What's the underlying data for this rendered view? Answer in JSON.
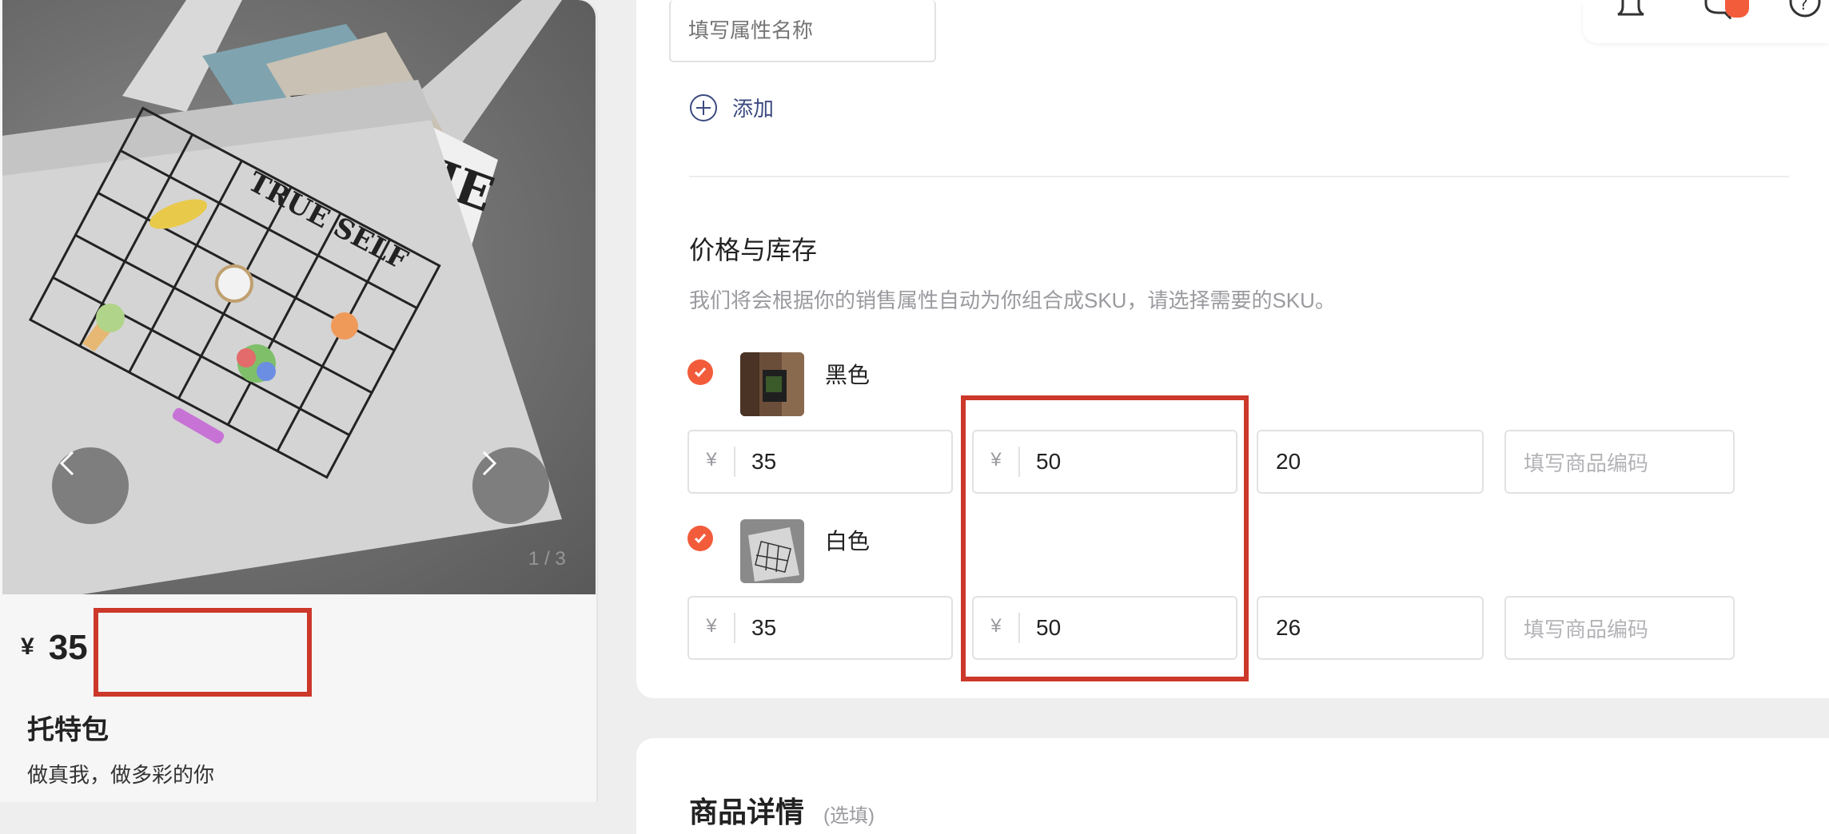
{
  "preview": {
    "page_indicator": "1 / 3",
    "currency": "¥",
    "price": "35",
    "title": "托特包",
    "subtitle": "做真我，做多彩的你",
    "bag_print_text": "TRUE SELF"
  },
  "attributes": {
    "name_placeholder": "填写属性名称",
    "add_label": "添加"
  },
  "pricing": {
    "title": "价格与库存",
    "description": "我们将会根据你的销售属性自动为你组合成SKU，请选择需要的SKU。",
    "currency": "¥",
    "skus": [
      {
        "name": "黑色",
        "checked": true,
        "price": "35",
        "original_price": "50",
        "stock": "20",
        "code_placeholder": "填写商品编码"
      },
      {
        "name": "白色",
        "checked": true,
        "price": "35",
        "original_price": "50",
        "stock": "26",
        "code_placeholder": "填写商品编码"
      }
    ]
  },
  "details": {
    "title": "商品详情",
    "note": "(选填)"
  },
  "colors": {
    "accent": "#f25c3b",
    "highlight": "#cc3829",
    "link": "#3c4a80"
  }
}
